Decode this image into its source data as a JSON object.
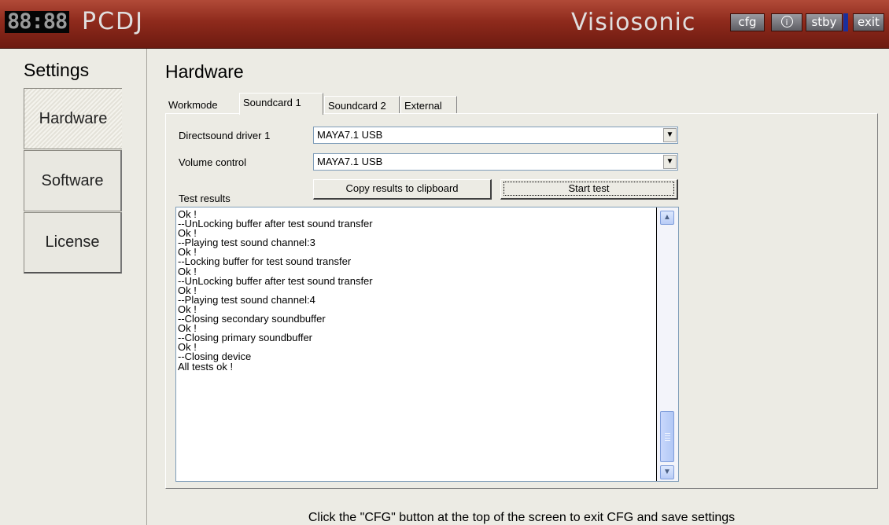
{
  "topbar": {
    "clock": "88:88",
    "app_name": "PCDJ",
    "brand": "Visiosonic",
    "buttons": {
      "cfg": "cfg",
      "info": "i",
      "stby": "stby",
      "exit": "exit"
    },
    "colors": {
      "bar": "#8e2a1c",
      "standby_indicator": "#1a2f9c"
    }
  },
  "sidebar": {
    "title": "Settings",
    "items": [
      {
        "label": "Hardware",
        "active": true
      },
      {
        "label": "Software",
        "active": false
      },
      {
        "label": "License",
        "active": false
      }
    ]
  },
  "main": {
    "title": "Hardware",
    "tabs": [
      {
        "label": "Workmode",
        "active": false
      },
      {
        "label": "Soundcard 1",
        "active": true
      },
      {
        "label": "Soundcard 2",
        "active": false
      },
      {
        "label": "External",
        "active": false
      }
    ],
    "driver": {
      "label": "Directsound driver 1",
      "value": "MAYA7.1 USB"
    },
    "volume": {
      "label": "Volume control",
      "value": "MAYA7.1 USB"
    },
    "test_results_label": "Test results",
    "copy_button": "Copy results to clipboard",
    "start_button": "Start test",
    "results_lines": [
      "Ok !",
      "--UnLocking buffer after test sound transfer",
      "Ok !",
      "--Playing test sound channel:3",
      "Ok !",
      "--Locking buffer for test sound transfer",
      "Ok !",
      "--UnLocking buffer after test sound transfer",
      "Ok !",
      "--Playing test sound channel:4",
      "Ok !",
      "--Closing secondary soundbuffer",
      "Ok !",
      "--Closing primary soundbuffer",
      "Ok !",
      "--Closing device",
      "All tests ok !"
    ],
    "scroll_position": 1.0
  },
  "footer": "Click the \"CFG\" button at the top of the screen to exit CFG and save settings"
}
